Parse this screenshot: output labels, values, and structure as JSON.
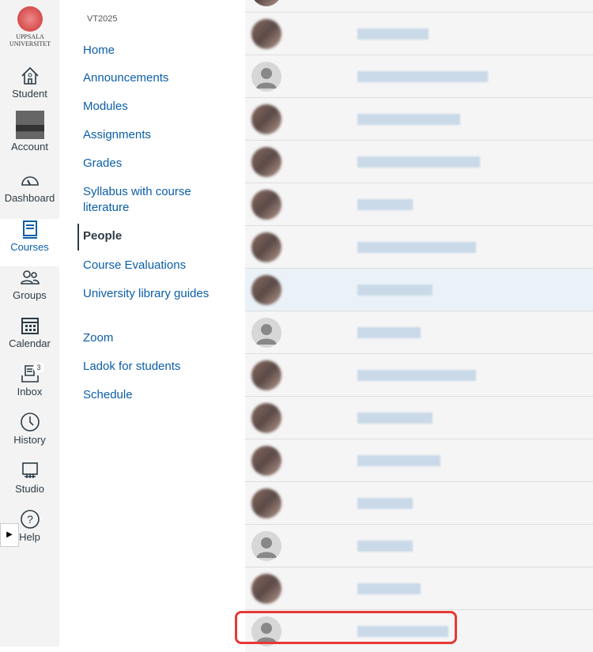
{
  "logo": {
    "text": "UPPSALA UNIVERSITET"
  },
  "global_nav": [
    {
      "label": "Student",
      "icon": "home-icon"
    },
    {
      "label": "Account",
      "icon": "avatar"
    },
    {
      "label": "Dashboard",
      "icon": "dashboard-icon"
    },
    {
      "label": "Courses",
      "icon": "book-icon",
      "active": true
    },
    {
      "label": "Groups",
      "icon": "groups-icon"
    },
    {
      "label": "Calendar",
      "icon": "calendar-icon"
    },
    {
      "label": "Inbox",
      "icon": "inbox-icon",
      "badge": "3"
    },
    {
      "label": "History",
      "icon": "clock-icon"
    },
    {
      "label": "Studio",
      "icon": "studio-icon"
    },
    {
      "label": "Help",
      "icon": "help-icon"
    }
  ],
  "course_nav": {
    "term": "VT2025",
    "items": [
      "Home",
      "Announcements",
      "Modules",
      "Assignments",
      "Grades",
      "Syllabus with course literature",
      "People",
      "Course Evaluations",
      "University library guides",
      "Zoom",
      "Ladok for students",
      "Schedule"
    ],
    "active": "People"
  },
  "people": {
    "rows": [
      "photo",
      "default",
      "photo",
      "photo",
      "photo",
      "photo",
      "photo",
      "default",
      "photo",
      "photo",
      "photo",
      "photo",
      "default",
      "photo",
      "default"
    ],
    "highlighted_row": 6,
    "selected_row": 14
  },
  "colors": {
    "link": "#0b5ea8",
    "highlight": "#e53935"
  }
}
